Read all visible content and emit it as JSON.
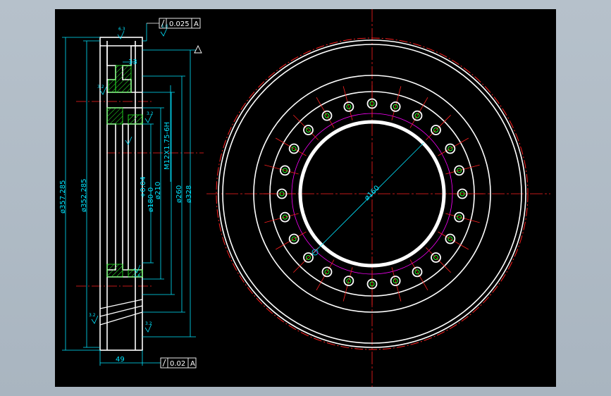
{
  "drawing": {
    "tolerance_top": {
      "value": "0.025",
      "datum": "A"
    },
    "tolerance_bottom": {
      "value": "0.02",
      "datum": "A"
    },
    "dimensions": {
      "d_357": "ø357.285",
      "d_352": "ø352.285",
      "thread": "M12X1.75-6H",
      "d_210": "ø210",
      "d_260": "ø260",
      "d_328": "ø328",
      "d_180": "ø180-0",
      "d_180_tol": "+0.04",
      "d_160": "ø160",
      "width_49": "49",
      "dim_13": "13"
    },
    "roughness": {
      "r1": "6.3",
      "r2": "1.6",
      "r3": "3.2",
      "r4": "3.2",
      "r5": "1.6",
      "r6": "3.2",
      "r7": "3.2"
    },
    "holes": {
      "count": 24
    },
    "colors": {
      "outline": "#ffffff",
      "center_line": "#ff2020",
      "dimension": "#00e5ff",
      "hatch": "#2bff2b",
      "pitch_circle": "#ff00ff"
    }
  }
}
